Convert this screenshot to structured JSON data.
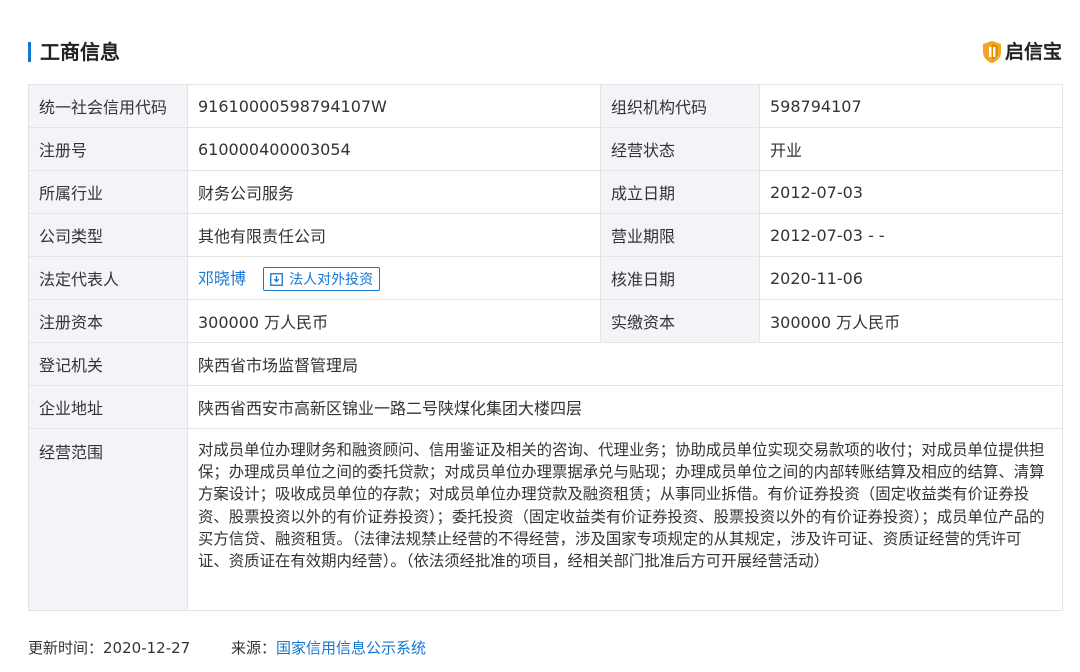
{
  "header": {
    "title": "工商信息",
    "brand": "启信宝"
  },
  "table": {
    "credit_code_label": "统一社会信用代码",
    "credit_code": "91610000598794107W",
    "org_code_label": "组织机构代码",
    "org_code": "598794107",
    "reg_no_label": "注册号",
    "reg_no": "610000400003054",
    "status_label": "经营状态",
    "status": "开业",
    "industry_label": "所属行业",
    "industry": "财务公司服务",
    "founded_label": "成立日期",
    "founded": "2012-07-03",
    "company_type_label": "公司类型",
    "company_type": "其他有限责任公司",
    "term_label": "营业期限",
    "term": "2012-07-03 - -",
    "legal_rep_label": "法定代表人",
    "legal_rep": "邓晓博",
    "invest_button": "法人对外投资",
    "approved_label": "核准日期",
    "approved": "2020-11-06",
    "reg_capital_label": "注册资本",
    "reg_capital": "300000 万人民币",
    "paid_capital_label": "实缴资本",
    "paid_capital": "300000 万人民币",
    "authority_label": "登记机关",
    "authority": "陕西省市场监督管理局",
    "address_label": "企业地址",
    "address": "陕西省西安市高新区锦业一路二号陕煤化集团大楼四层",
    "scope_label": "经营范围",
    "scope": "对成员单位办理财务和融资顾问、信用鉴证及相关的咨询、代理业务；协助成员单位实现交易款项的收付；对成员单位提供担保；办理成员单位之间的委托贷款；对成员单位办理票据承兑与贴现；办理成员单位之间的内部转账结算及相应的结算、清算方案设计；吸收成员单位的存款；对成员单位办理贷款及融资租赁；从事同业拆借。有价证券投资（固定收益类有价证券投资、股票投资以外的有价证券投资）；委托投资（固定收益类有价证券投资、股票投资以外的有价证券投资）；成员单位产品的买方信贷、融资租赁。（法律法规禁止经营的不得经营，涉及国家专项规定的从其规定，涉及许可证、资质证经营的凭许可证、资质证在有效期内经营）。（依法须经批准的项目，经相关部门批准后方可开展经营活动）"
  },
  "footer": {
    "updated_label": "更新时间：",
    "updated": "2020-12-27",
    "source_label": "来源：",
    "source": "国家信用信息公示系统"
  },
  "colors": {
    "accent": "#1677d2",
    "label_bg": "#f2f4f7",
    "border": "#e4e4e4",
    "brand": "#f5a623"
  },
  "icons": {
    "brand": "shield-q-icon",
    "invest": "download-box-icon"
  }
}
